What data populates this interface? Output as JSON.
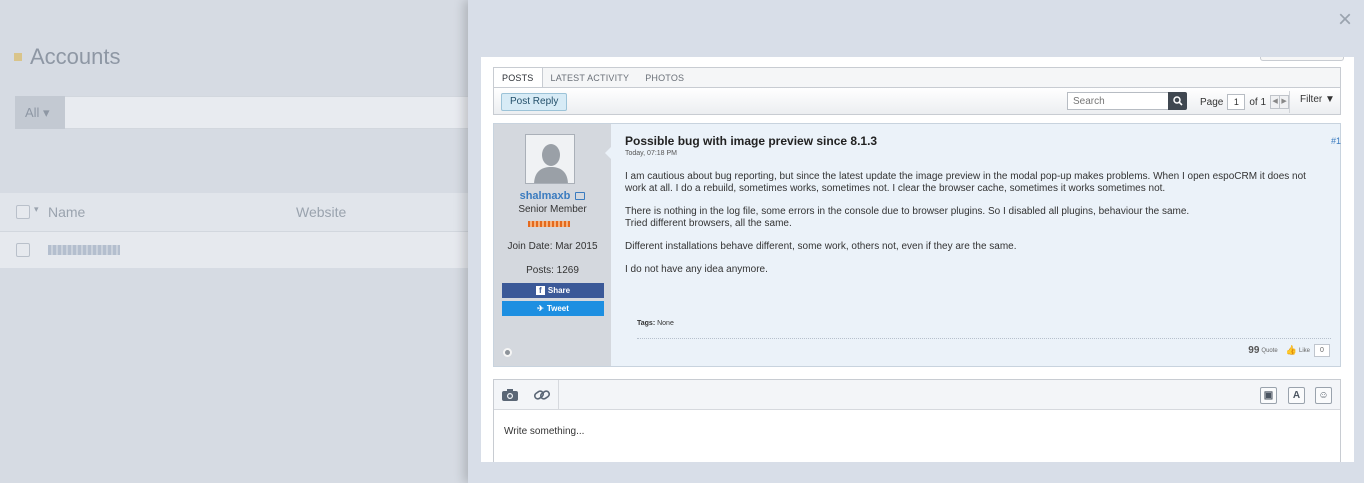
{
  "background": {
    "title": "Accounts",
    "filter_label": "All ▾",
    "columns": {
      "name": "Name",
      "website": "Website"
    }
  },
  "modal": {
    "close_label": "×",
    "tabs": [
      {
        "label": "POSTS",
        "active": true
      },
      {
        "label": "LATEST ACTIVITY",
        "active": false
      },
      {
        "label": "PHOTOS",
        "active": false
      }
    ],
    "toolbar": {
      "post_reply": "Post Reply",
      "search_placeholder": "Search",
      "page_label": "Page",
      "page_value": "1",
      "page_of": "of 1",
      "filter_label": "Filter ▼"
    },
    "post": {
      "author": "shalmaxb",
      "rank": "Senior Member",
      "join_date": "Join Date: Mar 2015",
      "posts": "Posts: 1269",
      "share_fb": "Share",
      "share_tw": "Tweet",
      "title": "Possible bug with image preview since 8.1.3",
      "date": "Today, 07:18 PM",
      "number": "#1",
      "paragraphs": [
        "I am cautious about bug reporting, but since the latest update the image preview in the modal pop-up makes problems. When I open espoCRM it does not work at all. I do a rebuild, sometimes works, sometimes not. I clear the browser cache, sometimes it works sometimes not.",
        "There is nothing in the log file, some errors in the console due to browser plugins. So I disabled all plugins, behaviour the same.\nTried different browsers, all the same.",
        "Different installations behave different, some work, others not, even if they are the same.",
        "I do not have any idea anymore."
      ],
      "tags_label": "Tags:",
      "tags_value": "None",
      "quote_label": "Quote",
      "like_label": "Like",
      "like_count": "0"
    },
    "editor": {
      "placeholder": "Write something..."
    },
    "colors": {
      "accent_link": "#3a7bbf",
      "reply_button": "#d7ebf6",
      "facebook": "#3b5998",
      "twitter": "#1d8fe1"
    }
  }
}
